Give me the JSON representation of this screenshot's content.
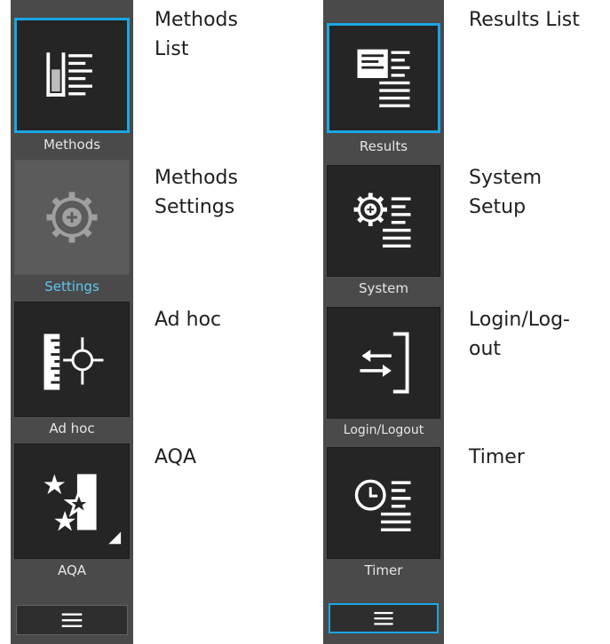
{
  "left_panel": {
    "tiles": [
      {
        "caption": "Methods",
        "icon": "methods-list-icon",
        "state": "selected"
      },
      {
        "caption": "Settings",
        "icon": "gear-icon",
        "state": "disabled-active"
      },
      {
        "caption": "Ad hoc",
        "icon": "ad-hoc-target-icon",
        "state": "normal"
      },
      {
        "caption": "AQA",
        "icon": "stars-icon",
        "state": "normal"
      }
    ],
    "menu_icon": "hamburger-menu-icon"
  },
  "right_panel": {
    "tiles": [
      {
        "caption": "Results",
        "icon": "results-list-icon",
        "state": "selected"
      },
      {
        "caption": "System",
        "icon": "gear-list-icon",
        "state": "normal"
      },
      {
        "caption": "Login/Logout",
        "icon": "login-arrows-icon",
        "state": "normal"
      },
      {
        "caption": "Timer",
        "icon": "clock-list-icon",
        "state": "normal"
      }
    ],
    "menu_icon": "hamburger-menu-icon"
  },
  "descriptions": {
    "left": [
      {
        "line1": "Methods",
        "line2": "List"
      },
      {
        "line1": "Methods",
        "line2": "Settings"
      },
      {
        "line1": "Ad hoc",
        "line2": ""
      },
      {
        "line1": "AQA",
        "line2": ""
      }
    ],
    "right": [
      {
        "line1": "Results List",
        "line2": ""
      },
      {
        "line1": "System",
        "line2": "Setup"
      },
      {
        "line1": "Login/Log-",
        "line2": "out"
      },
      {
        "line1": "Timer",
        "line2": ""
      }
    ]
  },
  "colors": {
    "panel": "#4a4a4a",
    "tile": "#252525",
    "selection_accent": "#1aa6e4",
    "active_caption": "#5ec8ef"
  }
}
